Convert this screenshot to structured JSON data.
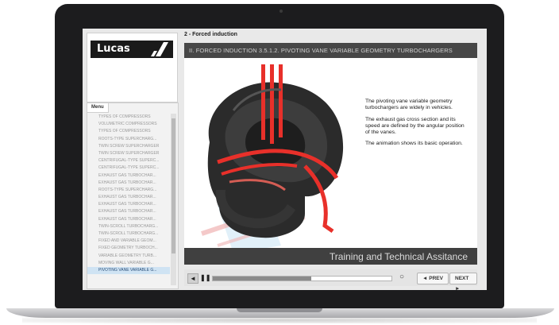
{
  "app": {
    "logo_text": "Lucas",
    "section_title": "2 - Forced induction",
    "slide_title": "II. FORCED INDUCTION 3.5.1.2. PIVOTING VANE VARIABLE GEOMETRY TURBOCHARGERS"
  },
  "menu": {
    "tab_label": "Menu",
    "items": [
      {
        "label": "TYPES OF COMPRESSORS"
      },
      {
        "label": "VOLUMETRIC COMPRESSORS"
      },
      {
        "label": "TYPES OF COMPRESSORS"
      },
      {
        "label": "ROOTS-TYPE SUPERCHARG..."
      },
      {
        "label": "TWIN SCREW SUPERCHARGER"
      },
      {
        "label": "TWIN SCREW SUPERCHARGER"
      },
      {
        "label": "CENTRIFUGAL-TYPE SUPERC..."
      },
      {
        "label": "CENTRIFUGAL-TYPE SUPERC..."
      },
      {
        "label": "EXHAUST GAS TURBOCHAR..."
      },
      {
        "label": "EXHAUST GAS TURBOCHAR..."
      },
      {
        "label": "ROOTS-TYPE SUPERCHARG..."
      },
      {
        "label": "EXHAUST GAS TURBOCHAR..."
      },
      {
        "label": "EXHAUST GAS TURBOCHAR..."
      },
      {
        "label": "EXHAUST GAS TURBOCHAR..."
      },
      {
        "label": "EXHAUST GAS TURBOCHAR..."
      },
      {
        "label": "TWIN-SCROLL TURBOCHARG..."
      },
      {
        "label": "TWIN-SCROLL TURBOCHARG..."
      },
      {
        "label": "FIXED AND VARIABLE GEOM..."
      },
      {
        "label": "FIXED GEOMETRY TURBOCH..."
      },
      {
        "label": "VARIABLE GEOMETRY TURB..."
      },
      {
        "label": "MOVING WALL VARIABLE G..."
      },
      {
        "label": "PIVOTING VANE VARIABLE G..."
      }
    ],
    "active_index": 21
  },
  "content": {
    "paragraphs": [
      "The pivoting vane variable geometry turbochargers are widely in vehicles.",
      "The exhaust gas cross section and its speed are defined by the angular position of the vanes.",
      "The animation shows its basic operation."
    ],
    "footer_text": "Training and Technical Assitance"
  },
  "controls": {
    "rewind_icon": "◄",
    "pause_icon": "❚❚",
    "replay_icon": "○",
    "progress": 0.55,
    "prev_label": "◄ PREV",
    "next_label": "NEXT ►"
  },
  "colors": {
    "accent_red": "#e8302a",
    "title_bar": "#474747",
    "active_menu": "#cfe3f3"
  }
}
